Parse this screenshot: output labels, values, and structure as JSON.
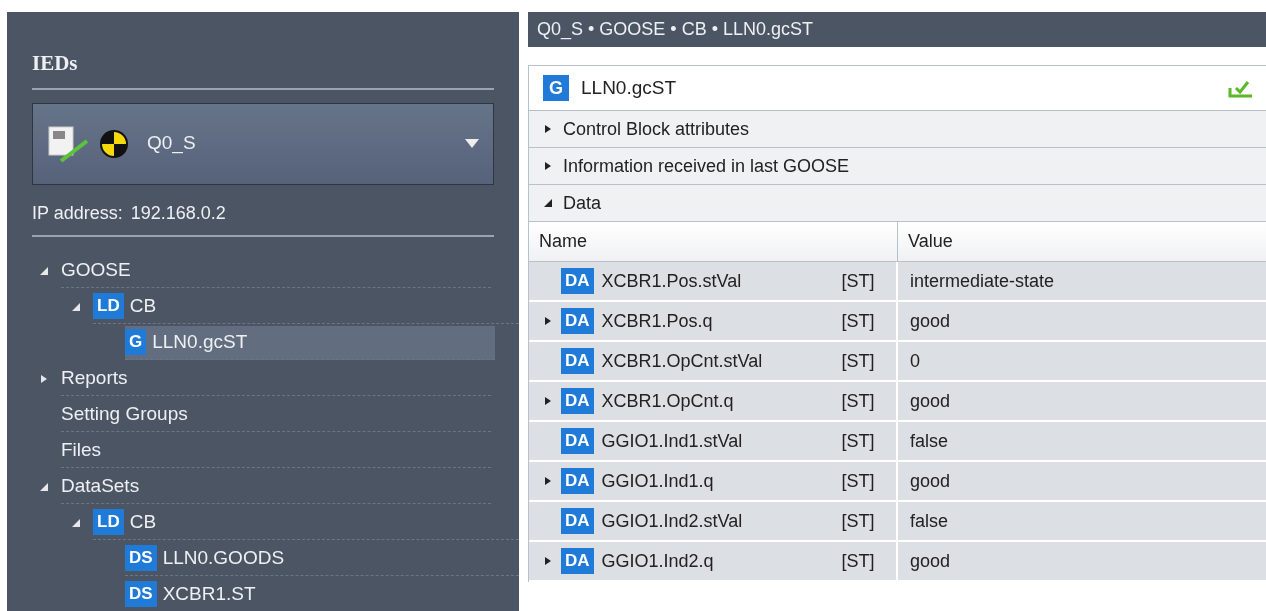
{
  "sidebar": {
    "title": "IEDs",
    "device": {
      "name": "Q0_S"
    },
    "ip_label": "IP address:",
    "ip_value": "192.168.0.2",
    "tree": [
      {
        "label": "GOOSE",
        "expanded": true,
        "children": [
          {
            "badge": "LD",
            "label": "CB",
            "expanded": true,
            "children": [
              {
                "badge": "G",
                "label": "LLN0.gcST",
                "selected": true
              }
            ]
          }
        ]
      },
      {
        "label": "Reports",
        "expanded": false,
        "selected": false
      },
      {
        "label": "Setting Groups",
        "selected": false
      },
      {
        "label": "Files",
        "selected": false
      },
      {
        "label": "DataSets",
        "expanded": true,
        "children": [
          {
            "badge": "LD",
            "label": "CB",
            "expanded": true,
            "children": [
              {
                "badge": "DS",
                "label": "LLN0.GOODS",
                "selected": false
              },
              {
                "badge": "DS",
                "label": "XCBR1.ST",
                "selected": false
              }
            ]
          }
        ]
      }
    ]
  },
  "breadcrumb": "Q0_S • GOOSE • CB • LLN0.gcST",
  "card": {
    "badge": "G",
    "title": "LLN0.gcST",
    "sections": [
      {
        "label": "Control Block attributes",
        "expanded": false
      },
      {
        "label": "Information received in last GOOSE",
        "expanded": false
      },
      {
        "label": "Data",
        "expanded": true
      }
    ],
    "table": {
      "columns": [
        "Name",
        "Value"
      ],
      "rows": [
        {
          "badge": "DA",
          "name": "XCBR1.Pos.stVal",
          "fc": "[ST]",
          "value": "intermediate-state"
        },
        {
          "badge": "DA",
          "name": "XCBR1.Pos.q",
          "fc": "[ST]",
          "value": "good",
          "expanded": false
        },
        {
          "badge": "DA",
          "name": "XCBR1.OpCnt.stVal",
          "fc": "[ST]",
          "value": "0"
        },
        {
          "badge": "DA",
          "name": "XCBR1.OpCnt.q",
          "fc": "[ST]",
          "value": "good",
          "expanded": false
        },
        {
          "badge": "DA",
          "name": "GGIO1.Ind1.stVal",
          "fc": "[ST]",
          "value": "false"
        },
        {
          "badge": "DA",
          "name": "GGIO1.Ind1.q",
          "fc": "[ST]",
          "value": "good",
          "expanded": false
        },
        {
          "badge": "DA",
          "name": "GGIO1.Ind2.stVal",
          "fc": "[ST]",
          "value": "false"
        },
        {
          "badge": "DA",
          "name": "GGIO1.Ind2.q",
          "fc": "[ST]",
          "value": "good",
          "expanded": false
        }
      ]
    }
  }
}
